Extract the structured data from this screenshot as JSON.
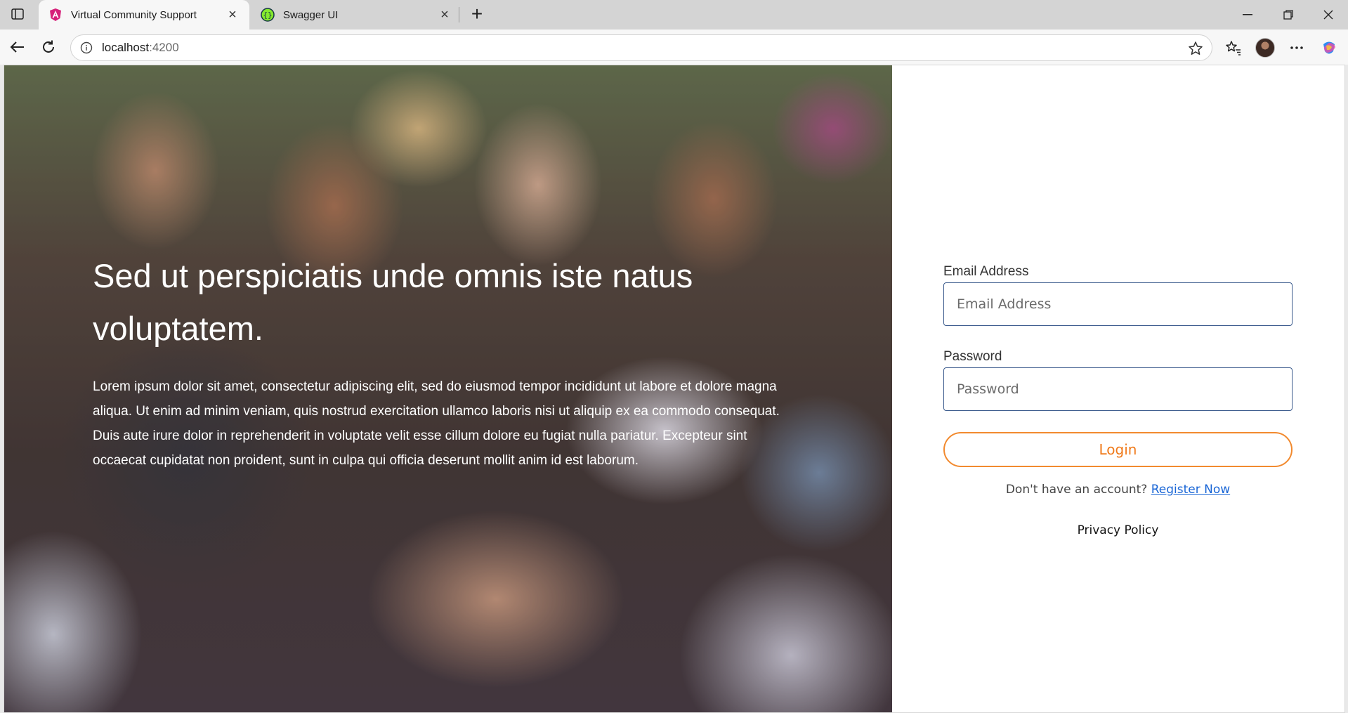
{
  "browser": {
    "tabs": [
      {
        "title": "Virtual Community Support",
        "active": true,
        "icon": "angular-icon"
      },
      {
        "title": "Swagger UI",
        "active": false,
        "icon": "swagger-icon"
      }
    ],
    "address": {
      "host": "localhost",
      "port": ":4200"
    }
  },
  "hero": {
    "title": "Sed ut perspiciatis unde omnis iste natus voluptatem.",
    "body": "Lorem ipsum dolor sit amet, consectetur adipiscing elit, sed do eiusmod tempor incididunt ut labore et dolore magna aliqua. Ut enim ad minim veniam, quis nostrud exercitation ullamco laboris nisi ut aliquip ex ea commodo consequat. Duis aute irure dolor in reprehenderit in voluptate velit esse cillum dolore eu fugiat nulla pariatur. Excepteur sint occaecat cupidatat non proident, sunt in culpa qui officia deserunt mollit anim id est laborum."
  },
  "login": {
    "email_label": "Email Address",
    "email_placeholder": "Email Address",
    "email_value": "",
    "password_label": "Password",
    "password_placeholder": "Password",
    "password_value": "",
    "login_button": "Login",
    "register_prompt": "Don't have an account?",
    "register_link": "Register Now",
    "privacy_link": "Privacy Policy"
  },
  "colors": {
    "accent": "#f28a2f",
    "input_border": "#3a5a8c",
    "link": "#1a66d6"
  }
}
